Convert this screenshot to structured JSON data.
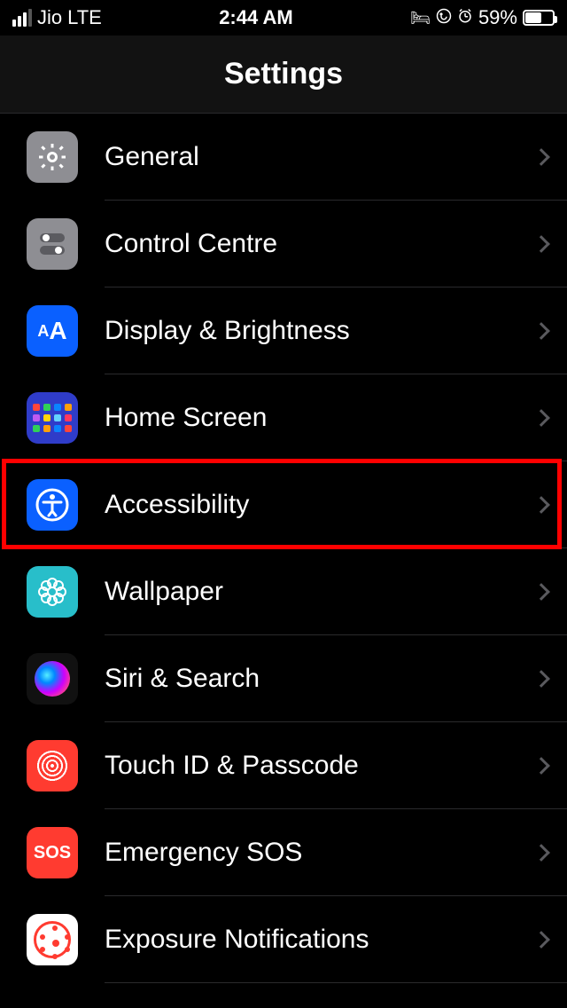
{
  "status": {
    "carrier": "Jio",
    "network": "LTE",
    "time": "2:44 AM",
    "battery_pct": "59%"
  },
  "header": {
    "title": "Settings"
  },
  "rows": [
    {
      "label": "General"
    },
    {
      "label": "Control Centre"
    },
    {
      "label": "Display & Brightness"
    },
    {
      "label": "Home Screen"
    },
    {
      "label": "Accessibility"
    },
    {
      "label": "Wallpaper"
    },
    {
      "label": "Siri & Search"
    },
    {
      "label": "Touch ID & Passcode"
    },
    {
      "label": "Emergency SOS"
    },
    {
      "label": "Exposure Notifications"
    }
  ],
  "sos_text": "SOS",
  "aa_text": "AA"
}
